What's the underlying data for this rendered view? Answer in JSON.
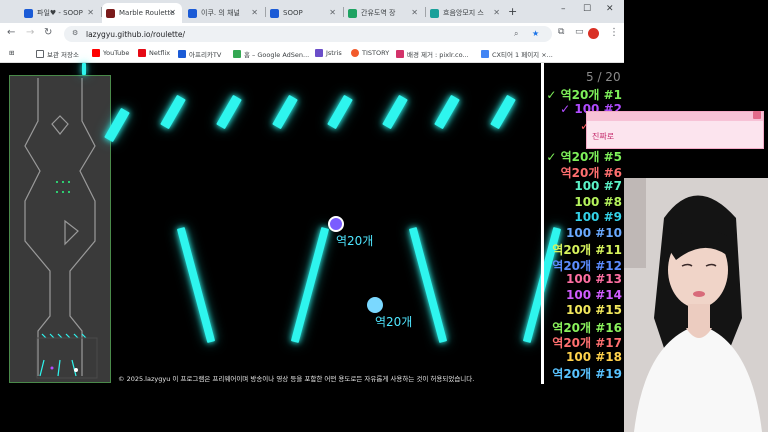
{
  "browser": {
    "tabs": [
      {
        "label": "파일♥ - SOOP"
      },
      {
        "label": "Marble Roulette"
      },
      {
        "label": "이쿠. 의 채널"
      },
      {
        "label": "SOOP"
      },
      {
        "label": "간유도역 장"
      },
      {
        "label": "흐음앙모지 스"
      }
    ],
    "newtab_label": "+",
    "window": {
      "minimize": "–",
      "maximize": "☐",
      "close": "✕"
    },
    "url": "lazygyu.github.io/roulette/",
    "bookmarks": [
      {
        "label": "보관 저장소",
        "color": "#f4b400"
      },
      {
        "label": "YouTube",
        "color": "#ff0000"
      },
      {
        "label": "Netflix",
        "color": "#e50914"
      },
      {
        "label": "아프리카TV",
        "color": "#1b5bd6"
      },
      {
        "label": "홈 – Google AdSen...",
        "color": "#34a853"
      },
      {
        "label": "Jstris",
        "color": "#6b4ec9"
      },
      {
        "label": "TISTORY",
        "color": "#f25a2b"
      },
      {
        "label": "배경 제거 : pixlr.co...",
        "color": "#d3336a"
      },
      {
        "label": "CX티어 1 페이지 ×...",
        "color": "#4285f4"
      }
    ]
  },
  "game": {
    "counter": "5 / 20",
    "marbles": [
      {
        "label": "역20개",
        "color": "#7a5cff"
      },
      {
        "label": "역20개",
        "color": "#7ad8ff"
      }
    ],
    "footer": "© 2025.lazygyu 이 프로그램은 프리웨어이며 방송이나 영상 등을 포함한 어떤 용도로든 자유롭게 사용하는 것이 허용되었습니다."
  },
  "ranking": [
    {
      "text": "✓ 역20개 #1",
      "color": "#7ef05a"
    },
    {
      "text": "✓ 100 #2",
      "color": "#b14cff"
    },
    {
      "text": "✓ 역20",
      "color": "#ff5e5e"
    },
    {
      "text": "✓ 10",
      "color": "#a66bff"
    },
    {
      "text": "✓ 역20개 #5",
      "color": "#7ef05a"
    },
    {
      "text": "역20개 #6",
      "color": "#ff6f6f"
    },
    {
      "text": "100 #7",
      "color": "#5cf2c8"
    },
    {
      "text": "100 #8",
      "color": "#b4f25c"
    },
    {
      "text": "100 #9",
      "color": "#34d3e9"
    },
    {
      "text": "100 #10",
      "color": "#6aa9ff"
    },
    {
      "text": "역20개 #11",
      "color": "#d6f25c"
    },
    {
      "text": "역20개 #12",
      "color": "#5c8cff"
    },
    {
      "text": "100 #13",
      "color": "#ff6fa2"
    },
    {
      "text": "100 #14",
      "color": "#d05cff"
    },
    {
      "text": "100 #15",
      "color": "#f2e85c"
    },
    {
      "text": "역20개 #16",
      "color": "#8af25c"
    },
    {
      "text": "역20개 #17",
      "color": "#ff7070"
    },
    {
      "text": "100 #18",
      "color": "#ffd24c"
    },
    {
      "text": "역20개 #19",
      "color": "#59c3ff"
    }
  ],
  "chat": {
    "text": "진짜로"
  }
}
